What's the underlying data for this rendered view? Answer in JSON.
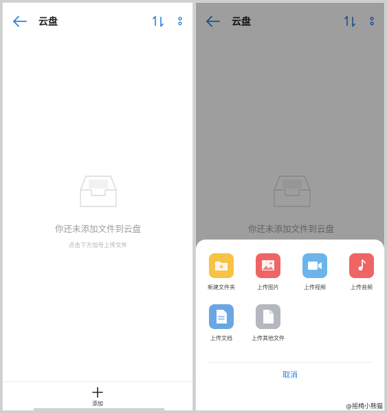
{
  "app": {
    "title": "云盘"
  },
  "empty": {
    "title": "你还未添加文件到云盘",
    "subtitle": "点击下方加号上传文件"
  },
  "bottom": {
    "add_label": "添加"
  },
  "sheet": {
    "options": [
      {
        "label": "新建文件夹",
        "icon": "folder-icon",
        "color": "#f8c245"
      },
      {
        "label": "上传图片",
        "icon": "image-icon",
        "color": "#ef6464"
      },
      {
        "label": "上传视频",
        "icon": "video-icon",
        "color": "#6bb5ec"
      },
      {
        "label": "上传音频",
        "icon": "music-icon",
        "color": "#ef6464"
      },
      {
        "label": "上传文档",
        "icon": "document-icon",
        "color": "#6aa6e3"
      },
      {
        "label": "上传其他文件",
        "icon": "file-icon",
        "color": "#b4b7be"
      }
    ],
    "cancel_label": "取消"
  },
  "colors": {
    "accent": "#2f7fd9"
  },
  "watermark": "@摇椅小熊猫"
}
